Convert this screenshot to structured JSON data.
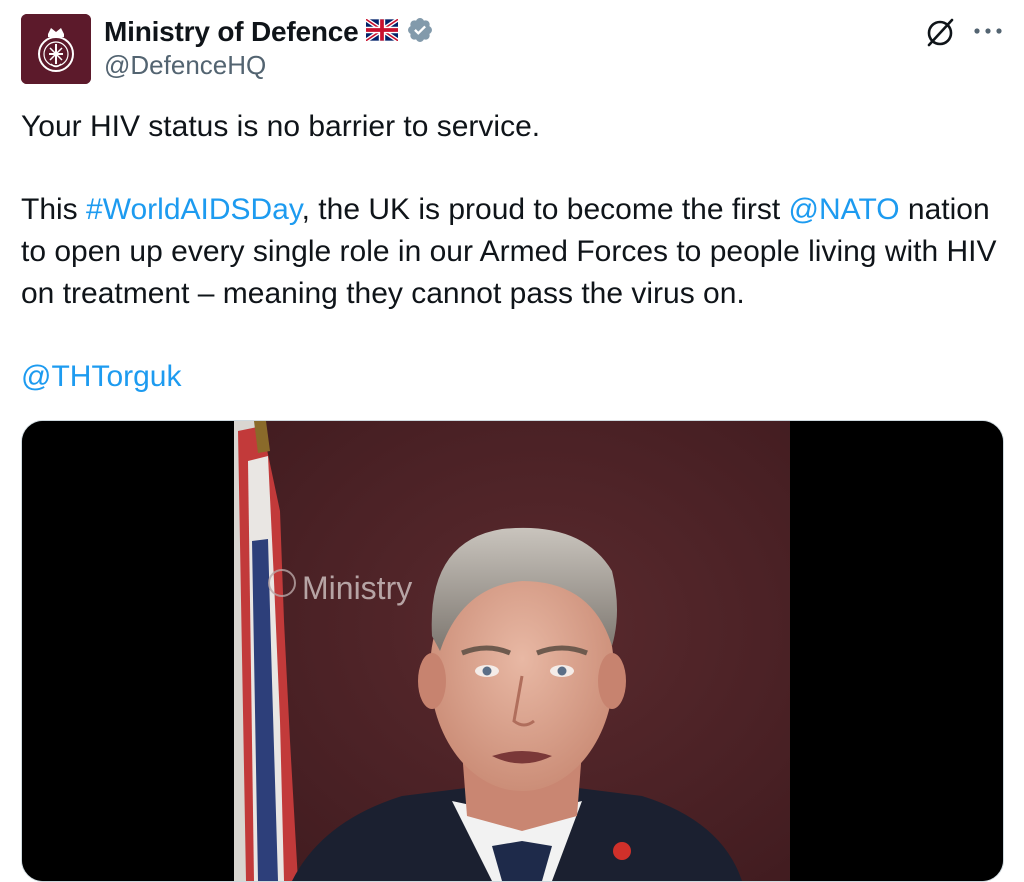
{
  "author": {
    "name": "Ministry of Defence",
    "handle": "@DefenceHQ",
    "flag_icon": "uk-flag-icon",
    "verified_icon": "verified-badge-icon",
    "verified_color": "#829aab"
  },
  "actions": {
    "grok_icon": "grok-icon",
    "more_icon": "more-icon"
  },
  "tweet": {
    "line1": "Your HIV status is no barrier to service.",
    "p2_a": "This ",
    "hashtag": "#WorldAIDSDay",
    "p2_b": ", the UK is proud to become the first ",
    "mention_nato": "@NATO",
    "p2_c": " nation to open up every single role in our Armed Forces to people living with HIV on treatment – meaning they cannot pass the virus on.",
    "mention_tht": "@THTorguk"
  },
  "media": {
    "backdrop_text": "Ministry"
  },
  "colors": {
    "link": "#1d9bf0",
    "avatar_bg": "#5c1a2b",
    "backdrop": "#4e2226"
  }
}
